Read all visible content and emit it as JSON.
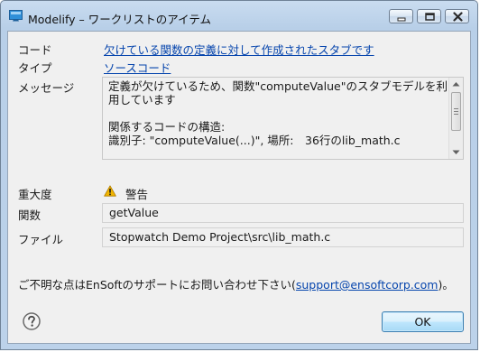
{
  "window": {
    "title": "Modelify – ワークリストのアイテム"
  },
  "details": {
    "code_label": "コード",
    "code_value": "欠けている関数の定義に対して作成されたスタブです",
    "type_label": "タイプ",
    "type_value": "ソースコード",
    "message_label": "メッセージ",
    "message_text": "定義が欠けているため、関数\"computeValue\"のスタブモデルを利用しています\n\n関係するコードの構造:\n識別子: \"computeValue(...)\", 場所:　36行のlib_math.c",
    "severity_label": "重大度",
    "severity_value": "警告",
    "function_label": "関数",
    "function_value": "getValue",
    "file_label": "ファイル",
    "file_value": "Stopwatch Demo Project\\src\\lib_math.c"
  },
  "footer": {
    "support_prefix": "ご不明な点はEnSoftのサポートにお問い合わせ下さい(",
    "support_email": "support@ensoftcorp.com",
    "support_suffix": ")。",
    "ok_label": "OK"
  },
  "icons": {
    "app": "window-icon",
    "minimize": "minimize-icon",
    "maximize": "maximize-icon",
    "close": "close-icon",
    "severity": "warning-icon",
    "help": "help-icon"
  },
  "colors": {
    "link": "#0645ad",
    "warning": "#f0b400",
    "titlebar": "#c9dcf0"
  }
}
